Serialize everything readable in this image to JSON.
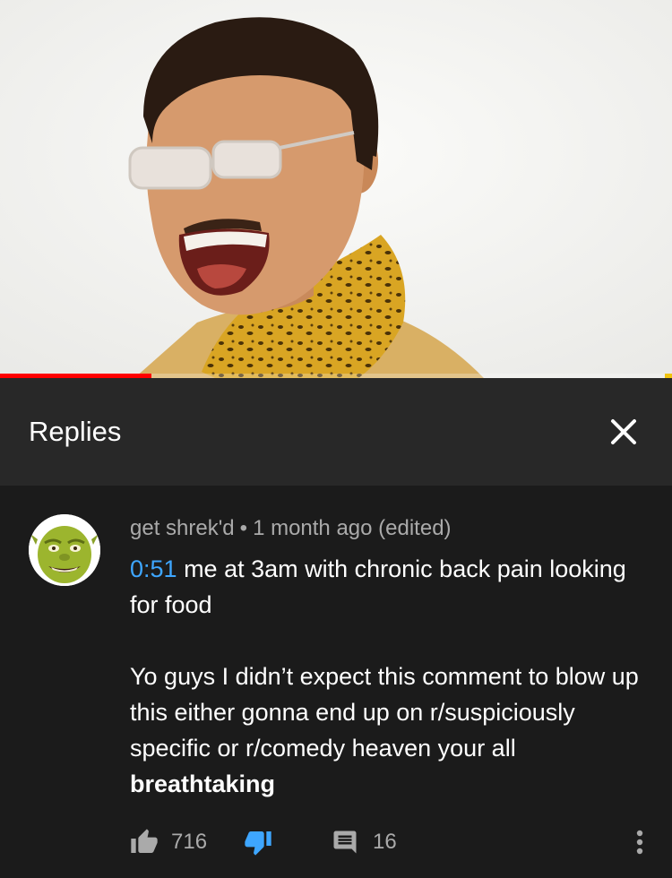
{
  "video": {
    "progress": 0.225
  },
  "replies_panel": {
    "title": "Replies",
    "close_icon": "close-icon"
  },
  "comment": {
    "author": "get shrek'd",
    "separator": "•",
    "time": "1 month ago (edited)",
    "timestamp": "0:51",
    "line1_rest": " me at 3am with chronic back pain looking for food",
    "paragraph2": "Yo guys I didn’t expect this comment to blow up this either gonna end up on r/suspiciously specific or r/comedy heaven your all",
    "paragraph2_bold": "breathtaking",
    "likes": "716",
    "replies": "16"
  },
  "colors": {
    "link": "#3ea6ff",
    "like_icon": "#aaaaaa",
    "dislike_icon": "#3ea6ff",
    "progress": "#ff0000"
  },
  "icons": {
    "like": "thumbs-up-icon",
    "dislike": "thumbs-down-icon",
    "reply": "comment-icon",
    "more": "more-vertical-icon"
  }
}
